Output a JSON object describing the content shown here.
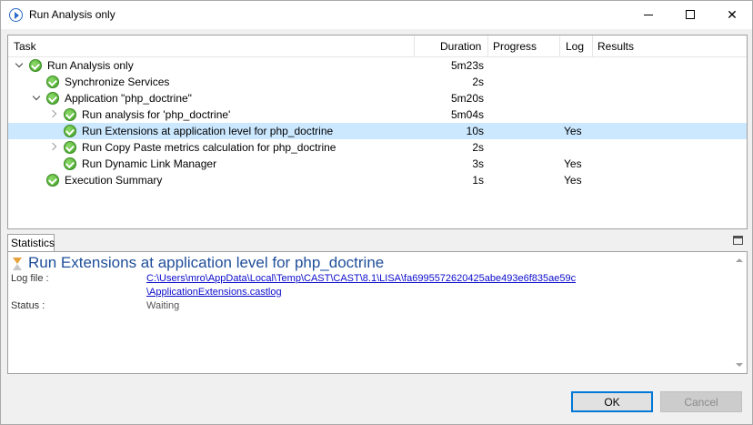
{
  "window": {
    "title": "Run Analysis only",
    "controls": {
      "minimize": "minimize",
      "maximize": "maximize",
      "close": "✕"
    }
  },
  "tree": {
    "columns": [
      "Task",
      "Duration",
      "Progress",
      "Log",
      "Results"
    ],
    "rows": [
      {
        "task": "Run Analysis only",
        "duration": "5m23s",
        "log": "",
        "indent": 0,
        "expander": "down",
        "selected": false
      },
      {
        "task": "Synchronize Services",
        "duration": "2s",
        "log": "",
        "indent": 1,
        "expander": "none",
        "selected": false
      },
      {
        "task": "Application \"php_doctrine\"",
        "duration": "5m20s",
        "log": "",
        "indent": 1,
        "expander": "down",
        "selected": false
      },
      {
        "task": "Run analysis for 'php_doctrine'",
        "duration": "5m04s",
        "log": "",
        "indent": 2,
        "expander": "right",
        "selected": false
      },
      {
        "task": "Run Extensions at application level for php_doctrine",
        "duration": "10s",
        "log": "Yes",
        "indent": 2,
        "expander": "none",
        "selected": true
      },
      {
        "task": "Run Copy Paste metrics calculation for php_doctrine",
        "duration": "2s",
        "log": "",
        "indent": 2,
        "expander": "right",
        "selected": false
      },
      {
        "task": "Run Dynamic Link Manager",
        "duration": "3s",
        "log": "Yes",
        "indent": 2,
        "expander": "none",
        "selected": false
      },
      {
        "task": "Execution Summary",
        "duration": "1s",
        "log": "Yes",
        "indent": 1,
        "expander": "none",
        "selected": false
      }
    ]
  },
  "statistics": {
    "tab_label": "Statistics",
    "title": "Run Extensions at application level for php_doctrine",
    "log_file_label": "Log file :",
    "log_file_line1": "C:\\Users\\mro\\AppData\\Local\\Temp\\CAST\\CAST\\8.1\\LISA\\fa6995572620425abe493e6f835ae59c",
    "log_file_line2": "\\ApplicationExtensions.castlog",
    "status_label": "Status :",
    "status_value": "Waiting"
  },
  "buttons": {
    "ok": "OK",
    "cancel": "Cancel"
  },
  "colors": {
    "selection": "#cce8ff",
    "accent": "#0078d7",
    "title_blue": "#1f4e9a"
  }
}
